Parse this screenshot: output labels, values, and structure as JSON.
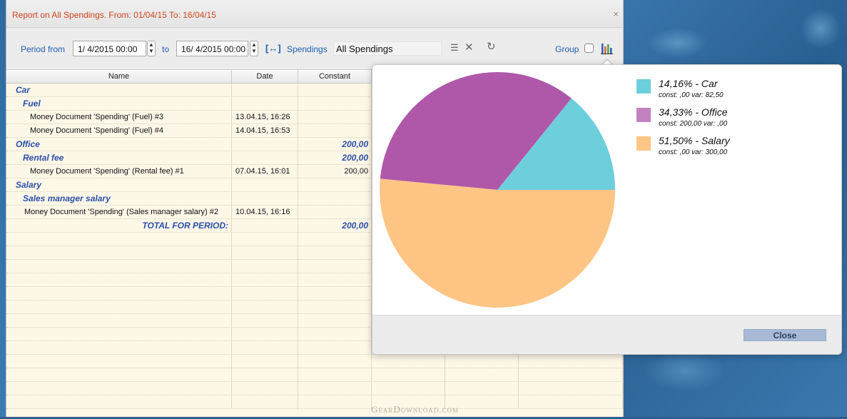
{
  "window": {
    "title": "Report on All Spendings. From: 01/04/15 To: 16/04/15",
    "close_glyph": "×"
  },
  "toolbar": {
    "period_from_label": "Period from",
    "date_from": "1/  4/2015 00:00",
    "to_label": "to",
    "date_to": "16/  4/2015 00:00",
    "range_icon": "[↔]",
    "spendings_label": "Spendings",
    "spendings_value": "All Spendings",
    "group_label": "Group",
    "icons": [
      "list-icon",
      "clear-icon",
      "refresh-icon",
      "bar-chart-icon"
    ]
  },
  "table": {
    "columns": [
      "Name",
      "Date",
      "Constant"
    ],
    "rows": [
      {
        "name": "Car",
        "date": "",
        "constant": "",
        "level": 0,
        "group": true
      },
      {
        "name": "Fuel",
        "date": "",
        "constant": "",
        "level": 1,
        "group": true
      },
      {
        "name": "Money Document 'Spending' (Fuel) #3",
        "date": "13.04.15, 16:26",
        "constant": "",
        "level": 2,
        "group": false
      },
      {
        "name": "Money Document 'Spending' (Fuel) #4",
        "date": "14.04.15, 16:53",
        "constant": "",
        "level": 2,
        "group": false
      },
      {
        "name": "Office",
        "date": "",
        "constant": "200,00",
        "level": 0,
        "group": true
      },
      {
        "name": "Rental fee",
        "date": "",
        "constant": "200,00",
        "level": 1,
        "group": true
      },
      {
        "name": "Money Document 'Spending' (Rental fee) #1",
        "date": "07.04.15, 16:01",
        "constant": "200,00",
        "level": 2,
        "group": false
      },
      {
        "name": "Salary",
        "date": "",
        "constant": "",
        "level": 0,
        "group": true
      },
      {
        "name": "Sales manager salary",
        "date": "",
        "constant": "",
        "level": 1,
        "group": true
      },
      {
        "name": "Money Document 'Spending' (Sales manager salary) #2",
        "date": "10.04.15, 16:16",
        "constant": "",
        "level": 2,
        "group": false
      },
      {
        "name": "TOTAL FOR PERIOD:",
        "date": "",
        "constant": "200,00",
        "level": 9,
        "group": true
      }
    ]
  },
  "popover": {
    "close_label": "Close",
    "legend": [
      {
        "pct": "14,16% - Car",
        "sub": "const: ,00  var: 82,50",
        "color": "#6dcfdc"
      },
      {
        "pct": "34,33% - Office",
        "sub": "const: 200,00  var: ,00",
        "color": "#c083c0"
      },
      {
        "pct": "51,50% - Salary",
        "sub": "const: ,00  var: 300,00",
        "color": "#ffc585"
      }
    ]
  },
  "chart_data": {
    "type": "pie",
    "categories": [
      "Car",
      "Office",
      "Salary"
    ],
    "values": [
      14.16,
      34.33,
      51.5
    ],
    "colors": [
      "#6dcfdc",
      "#af58a9",
      "#ffc585"
    ]
  },
  "watermark": "GearDownload.com"
}
